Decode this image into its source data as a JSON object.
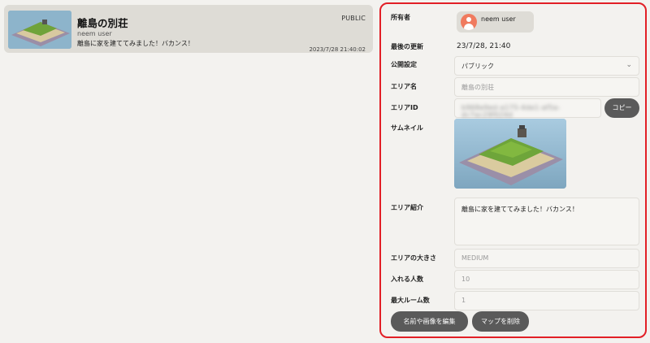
{
  "list": {
    "items": [
      {
        "title": "離島の別荘",
        "visibility": "PUBLIC",
        "owner": "neem user",
        "description": "離島に家を建ててみました！バカンス！",
        "timestamp": "2023/7/28 21:40:02"
      }
    ]
  },
  "details": {
    "labels": {
      "owner": "所有者",
      "updated": "最後の更新",
      "visibility": "公開設定",
      "area_name": "エリア名",
      "area_id": "エリアID",
      "thumbnail": "サムネイル",
      "intro": "エリア紹介",
      "size": "エリアの大きさ",
      "capacity": "入れる人数",
      "max_rooms": "最大ルーム数"
    },
    "owner_name": "neem user",
    "updated_value": "23/7/28, 21:40",
    "visibility_selected": "パブリック",
    "area_name_placeholder": "離島の別荘",
    "area_id_value": "b968e9ed-a175-4de1-af5a-dc7ac29f024d",
    "copy_label": "コピー",
    "intro_value": "離島に家を建ててみました！バカンス！",
    "size_value": "MEDIUM",
    "capacity_value": "10",
    "max_rooms_value": "1",
    "edit_label": "名前や画像を編集",
    "delete_label": "マップを削除"
  },
  "colors": {
    "panel_border": "#e21f26",
    "button_bg": "#5a5a5a",
    "card_bg": "#dedcd6",
    "avatar": "#f07a5e"
  }
}
